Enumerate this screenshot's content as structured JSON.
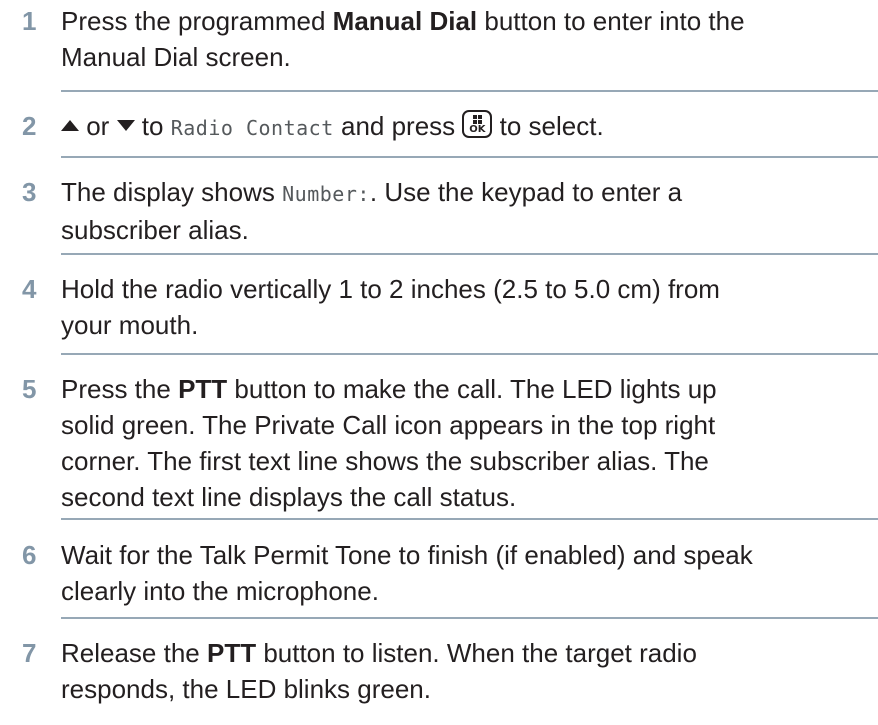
{
  "steps": [
    {
      "number": "1",
      "lines": [
        [
          "Press the programmed ",
          {
            "b": "Manual Dial"
          },
          " button to enter into the"
        ],
        [
          "Manual Dial screen."
        ]
      ]
    },
    {
      "number": "2",
      "lines": [
        [
          {
            "icon": "up"
          },
          " or ",
          {
            "icon": "down"
          },
          " to ",
          {
            "lcd": "Radio Contact"
          },
          " and press ",
          {
            "icon": "ok"
          },
          " to select."
        ]
      ]
    },
    {
      "number": "3",
      "lines": [
        [
          "The display shows ",
          {
            "lcd": "Number:"
          },
          ". Use the keypad to enter a"
        ],
        [
          "subscriber alias."
        ]
      ]
    },
    {
      "number": "4",
      "lines": [
        [
          "Hold the radio vertically 1 to 2 inches (2.5 to 5.0 cm) from"
        ],
        [
          "your mouth."
        ]
      ]
    },
    {
      "number": "5",
      "lines": [
        [
          "Press the ",
          {
            "b": "PTT"
          },
          " button to make the call. The LED lights up"
        ],
        [
          "solid green. The Private Call icon appears in the top right"
        ],
        [
          "corner. The first text line shows the subscriber alias. The"
        ],
        [
          "second text line displays the call status."
        ]
      ]
    },
    {
      "number": "6",
      "lines": [
        [
          "Wait for the Talk Permit Tone to finish (if enabled) and speak"
        ],
        [
          "clearly into the microphone."
        ]
      ]
    },
    {
      "number": "7",
      "lines": [
        [
          "Release the ",
          {
            "b": "PTT"
          },
          " button to listen. When the target radio"
        ],
        [
          "responds, the LED blinks green."
        ]
      ]
    }
  ],
  "icons": {
    "up": "up-arrow-icon",
    "down": "down-arrow-icon",
    "ok": "menu-ok-button-icon",
    "ok_label": "OK"
  },
  "colors": {
    "step_number": "#8296a7",
    "divider": "#97a8b6",
    "text": "#231f20"
  }
}
